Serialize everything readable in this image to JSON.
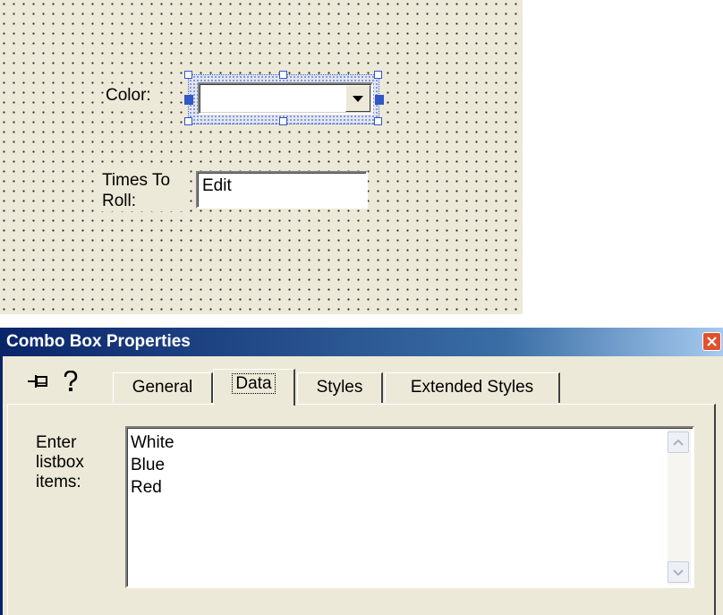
{
  "canvas": {
    "color_label": "Color:",
    "times_label_line1": "Times To",
    "times_label_line2": "Roll:",
    "edit_value": "Edit"
  },
  "dialog": {
    "title": "Combo Box Properties",
    "tabs": [
      {
        "label": "General"
      },
      {
        "label": "Data"
      },
      {
        "label": "Styles"
      },
      {
        "label": "Extended Styles"
      }
    ],
    "active_tab": "Data",
    "enter_label_line1": "Enter",
    "enter_label_line2": "listbox",
    "enter_label_line3": "items:",
    "items": [
      "White",
      "Blue",
      "Red"
    ]
  },
  "icons": {
    "pin": "pushpin-icon",
    "help": "question-mark-icon",
    "close": "close-icon",
    "dropdown": "chevron-down-icon"
  },
  "colors": {
    "title_bar": "#0a246a",
    "close_button": "#e0522e",
    "selection_handle": "#3257c7",
    "canvas_bg": "#ece9d8"
  }
}
